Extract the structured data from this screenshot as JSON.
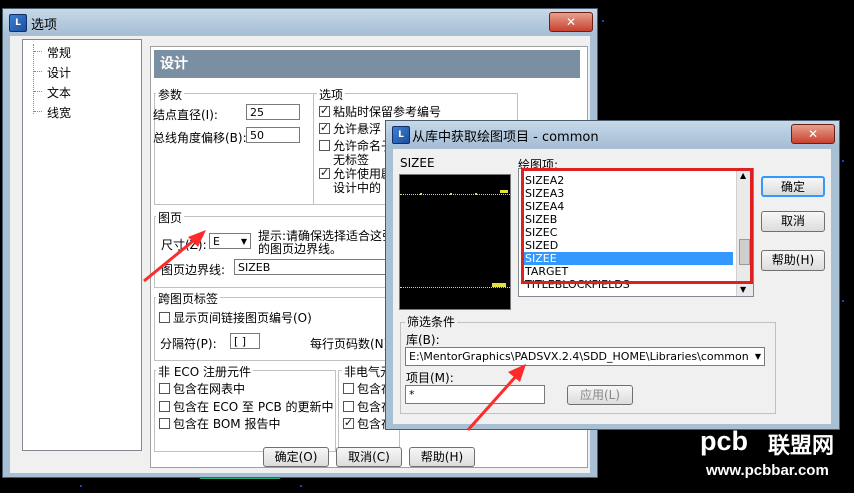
{
  "options_window": {
    "title": "选项",
    "close": "✕",
    "tree": [
      "常规",
      "设计",
      "文本",
      "线宽"
    ],
    "panel_title": "设计",
    "params": {
      "group": "参数",
      "node_diameter_label": "结点直径(I):",
      "node_diameter_value": "25",
      "bus_angle_label": "总线角度偏移(B):",
      "bus_angle_value": "50"
    },
    "options": {
      "group": "选项",
      "items": [
        {
          "label": "粘贴时保留参考编号",
          "checked": true
        },
        {
          "label": "允许悬浮",
          "checked": true
        },
        {
          "label": "允许命名子",
          "checked": false
        },
        {
          "label": "无标签",
          "checked": false
        },
        {
          "label": "允许使用剧",
          "checked": true
        },
        {
          "label": "设计中的",
          "checked": false
        }
      ]
    },
    "sheet": {
      "group": "图页",
      "size_label": "尺寸(Z):",
      "size_value": "E",
      "hint_line1": "提示:请确保选择适合这张",
      "hint_line2": "的图页边界线。",
      "border_label": "图页边界线:",
      "border_value": "SIZEB"
    },
    "cross_sheet": {
      "group": "跨图页标签",
      "show_link": "显示页间链接图页编号(O)",
      "separator_label": "分隔符(P):",
      "separator_value": "[ ]",
      "per_page_label": "每行页码数(N)"
    },
    "non_eco": {
      "group": "非 ECO 注册元件",
      "items": [
        "包含在网表中",
        "包含在 ECO 至 PCB 的更新中",
        "包含在 BOM 报告中"
      ]
    },
    "non_elec": {
      "group": "非电气元",
      "items": [
        {
          "label": "包含在",
          "checked": false
        },
        {
          "label": "包含在",
          "checked": false
        },
        {
          "label": "包含在",
          "checked": true
        }
      ]
    },
    "buttons": {
      "ok": "确定(O)",
      "cancel": "取消(C)",
      "help": "帮助(H)"
    }
  },
  "library_dialog": {
    "title": "从库中获取绘图项目 - common",
    "preview_label": "SIZEE",
    "items_label": "绘图项:",
    "items": [
      "SIZEA2",
      "SIZEA3",
      "SIZEA4",
      "SIZEB",
      "SIZEC",
      "SIZED",
      "SIZEE",
      "TARGET",
      "TITLEBLOCKFIELDS"
    ],
    "selected": "SIZEE",
    "buttons": {
      "ok": "确定",
      "cancel": "取消",
      "help": "帮助(H)"
    },
    "filter": {
      "group": "筛选条件",
      "library_label": "库(B):",
      "library_value": "E:\\MentorGraphics\\PADSVX.2.4\\SDD_HOME\\Libraries\\common",
      "item_label": "项目(M):",
      "item_value": "*",
      "apply": "应用(L)"
    }
  },
  "watermark": {
    "brand": "pcb",
    "cn": "联盟网",
    "url": "www.pcbbar.com"
  }
}
